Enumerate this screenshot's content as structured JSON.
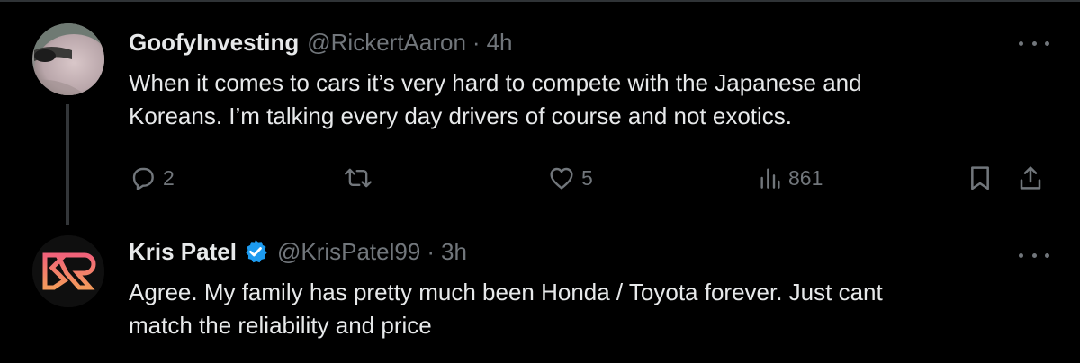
{
  "tweets": [
    {
      "display_name": "GoofyInvesting",
      "handle": "@RickertAaron",
      "separator": "·",
      "time": "4h",
      "verified": false,
      "text_lines": [
        "When it comes to cars it’s very hard to compete with the Japanese and",
        "Koreans. I’m talking every day drivers of course and not exotics."
      ],
      "actions": {
        "replies": "2",
        "reposts": "",
        "likes": "5",
        "views": "861"
      }
    },
    {
      "display_name": "Kris Patel",
      "handle": "@KrisPatel99",
      "separator": "·",
      "time": "3h",
      "verified": true,
      "text_lines": [
        "Agree. My family has pretty much been Honda / Toyota forever. Just cant",
        "match the reliability and price"
      ]
    }
  ],
  "colors": {
    "background": "#000000",
    "text": "#e7e9ea",
    "secondary": "#71767b",
    "verified": "#1d9bf0",
    "thread_line": "#333639",
    "logo_gradient_top": "#f2627a",
    "logo_gradient_bottom": "#f49a5c"
  },
  "icons": {
    "reply": "speech-bubble-icon",
    "repost": "repost-arrows-icon",
    "like": "heart-icon",
    "views": "bar-chart-icon",
    "bookmark": "bookmark-icon",
    "share": "share-upload-icon",
    "more": "more-dots-icon",
    "verified": "verified-badge-icon"
  }
}
